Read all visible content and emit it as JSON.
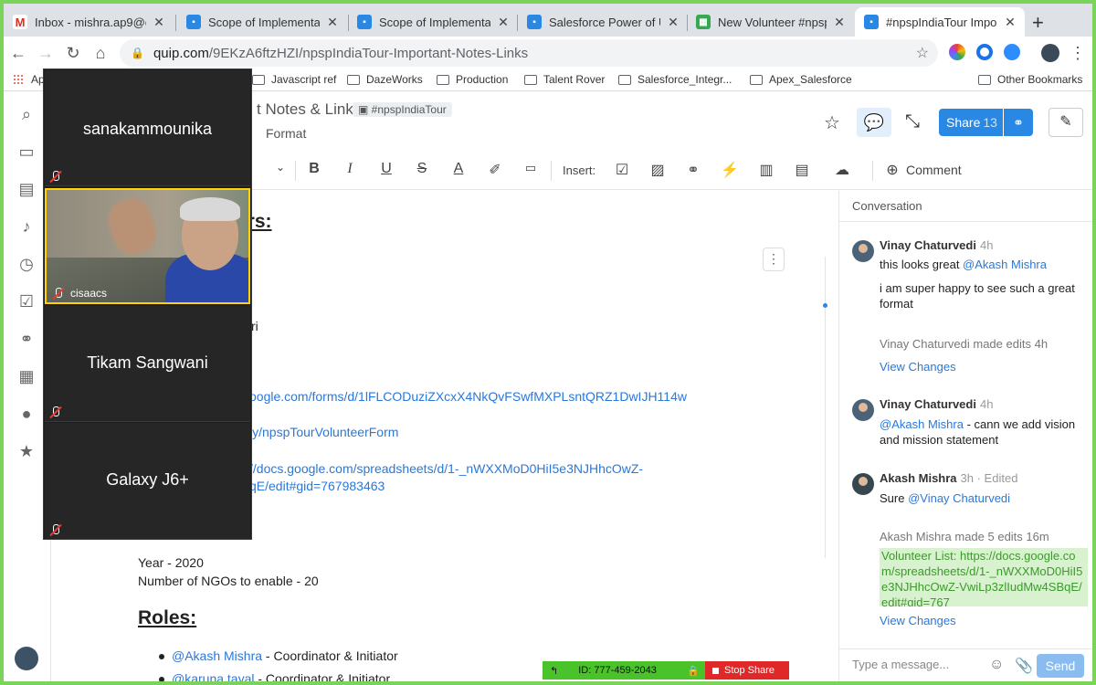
{
  "tabs": [
    {
      "title": "Inbox - mishra.ap9@gm",
      "icon": "gmail-icon",
      "active": false
    },
    {
      "title": "Scope of Implementatio",
      "icon": "quip-doc-icon",
      "active": false
    },
    {
      "title": "Scope of Implementatio",
      "icon": "quip-doc-icon",
      "active": false
    },
    {
      "title": "Salesforce Power of US",
      "icon": "quip-doc-icon",
      "active": false
    },
    {
      "title": "New Volunteer #npspIn",
      "icon": "quip-sheet-icon",
      "active": false
    },
    {
      "title": "#npspIndiaTour Importa",
      "icon": "quip-doc-icon",
      "active": true
    }
  ],
  "address": {
    "host": "quip.com",
    "path": "/9EKzA6ftzHZI/npspIndiaTour-Important-Notes-Links"
  },
  "bookmarks": {
    "apps": "Ap",
    "items": [
      "Javascript ref",
      "DazeWorks",
      "Production",
      "Talent Rover",
      "Salesforce_Integr...",
      "Apex_Salesforce"
    ],
    "other": "Other Bookmarks"
  },
  "doc": {
    "title_visible": "t Notes & Links",
    "tag": "#npspIndiaTour",
    "format_menu": "Format",
    "share_label": "Share",
    "share_count": "13"
  },
  "toolbar": {
    "insert_label": "Insert:",
    "comment_label": "Comment"
  },
  "body": {
    "heading_partial": "ers:",
    "partial_text": "ri",
    "link1": "oogle.com/forms/d/1lFLCODuziZXcxX4NkQvFSwfMXPLsntQRZ1DwIJH114w",
    "link2": "ly/npspTourVolunteerForm",
    "link3a": "//docs.google.com/spreadsheets/d/1-_nWXXMoD0HiI5e3NJHhcOwZ-",
    "link3b": "qE/edit#gid=767983463",
    "year": "Year - 2020",
    "ngos": "Number of NGOs to enable - 20",
    "roles_heading": "Roles:",
    "roles": [
      {
        "mention": "@Akash Mishra",
        "role": " - Coordinator & Initiator"
      },
      {
        "mention": "@karuna tayal",
        "role": " - Coordinator & Initiator"
      }
    ]
  },
  "conversation": {
    "title": "Conversation",
    "messages": [
      {
        "name": "Vinay Chaturvedi",
        "time": "4h",
        "line1_prefix": "this looks great ",
        "line1_mention": "@Akash Mishra",
        "line2": "i am super happy to see such a great format"
      },
      {
        "meta_name": "Vinay Chaturvedi",
        "meta_text": " made edits ",
        "meta_time": "4h",
        "link": "View Changes"
      },
      {
        "name": "Vinay Chaturvedi",
        "time": "4h",
        "mention": "@Akash Mishra",
        "text": " - cann we add vision and mission statement"
      },
      {
        "name": "Akash Mishra",
        "time": "3h · Edited",
        "prefix": "Sure ",
        "mention": "@Vinay Chaturvedi"
      },
      {
        "meta_name": "Akash Mishra",
        "meta_text": " made 5 edits ",
        "meta_time": "16m",
        "diff": "Volunteer List: https://docs.google.com/spreadsheets/d/1-_nWXXMoD0HiI5e3NJHhcOwZ-VwiLp3zlIudMw4SBqE/edit#gid=767",
        "link": "View Changes"
      }
    ],
    "input_placeholder": "Type a message...",
    "send_label": "Send"
  },
  "zoom": {
    "participants": [
      "sanakammounika",
      "cisaacs",
      "Tikam Sangwani",
      "Galaxy J6+"
    ],
    "meeting_id": "ID: 777-459-2043",
    "stop_share": "Stop Share"
  },
  "colors": {
    "share_border": "#7cd35a",
    "quip_blue": "#2a88e5",
    "zoom_green": "#4ac32a",
    "zoom_red": "#e02828"
  }
}
